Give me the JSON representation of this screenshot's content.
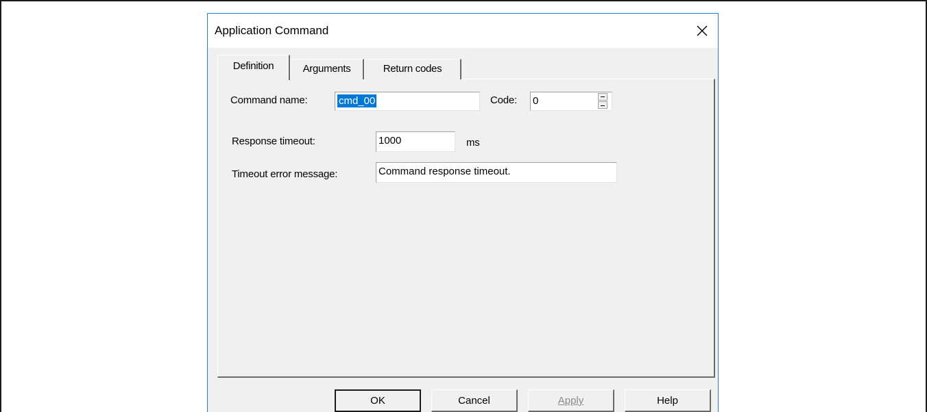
{
  "dialog": {
    "title": "Application Command",
    "close_icon": "close-icon"
  },
  "tabs": [
    {
      "label": "Definition",
      "active": true
    },
    {
      "label": "Arguments",
      "active": false
    },
    {
      "label": "Return codes",
      "active": false
    }
  ],
  "definition": {
    "command_name_label": "Command name:",
    "command_name_value": "cmd_00",
    "code_label": "Code:",
    "code_value": "0",
    "response_timeout_label": "Response timeout:",
    "response_timeout_value": "1000",
    "response_timeout_unit": "ms",
    "timeout_error_label": "Timeout error message:",
    "timeout_error_value": "Command response timeout."
  },
  "buttons": {
    "ok": "OK",
    "cancel": "Cancel",
    "apply": "Apply",
    "help": "Help"
  },
  "colors": {
    "selection": "#0078d7",
    "dialog_border": "#2b79d8",
    "dialog_background": "#f0f0f0"
  }
}
